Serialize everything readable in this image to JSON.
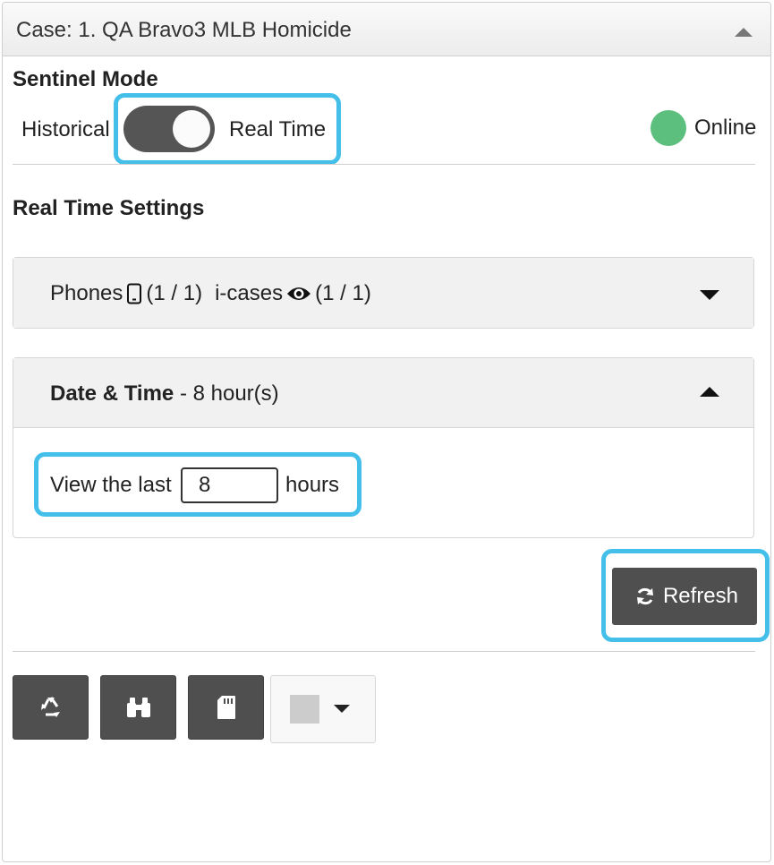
{
  "case_header": {
    "title": "Case: 1. QA Bravo3 MLB Homicide",
    "collapse_icon": "triangle-up-icon"
  },
  "sentinel": {
    "title": "Sentinel Mode",
    "left_label": "Historical",
    "right_label": "Real Time",
    "mode_real_time": true,
    "status_text": "Online",
    "status_color": "#5cbf7d"
  },
  "real_time_settings": {
    "title": "Real Time Settings"
  },
  "phones_section": {
    "phones_label": "Phones",
    "phones_icon": "mobile-phone-icon",
    "phones_count": "(1 / 1)",
    "icases_label": "i-cases",
    "icases_icon": "eye-icon",
    "icases_count": "(1 / 1)",
    "expand_icon": "caret-down-icon"
  },
  "datetime_section": {
    "title": "Date & Time",
    "summary": " - 8 hour(s)",
    "collapse_icon": "caret-up-icon",
    "view_prefix": "View the last",
    "hours_value": "8",
    "view_suffix": "hours"
  },
  "refresh": {
    "label": "Refresh",
    "icon": "refresh-icon"
  },
  "toolbar": {
    "buttons": [
      {
        "icon": "recycle-icon"
      },
      {
        "icon": "binoculars-icon"
      },
      {
        "icon": "sd-card-icon"
      }
    ],
    "color_picker": {
      "swatch_color": "#cccccc",
      "caret_icon": "caret-down-icon"
    }
  },
  "colors": {
    "highlight": "#43bfe9",
    "button_dark": "#4f4f4f"
  }
}
